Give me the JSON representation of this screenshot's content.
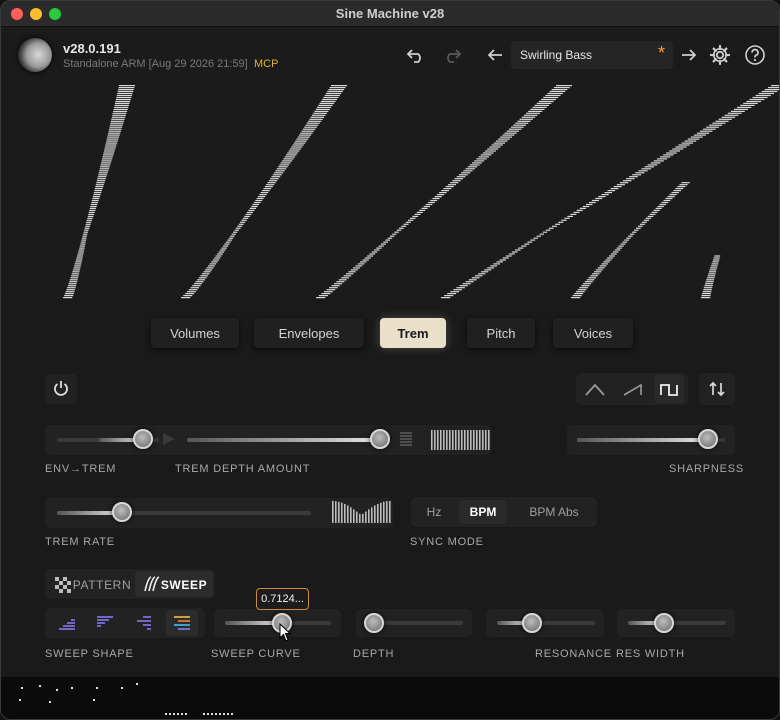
{
  "window": {
    "title": "Sine Machine v28"
  },
  "header": {
    "version": "v28.0.191",
    "build_info": "Standalone ARM [Aug 29 2026 21:59]",
    "badge": "MCP",
    "preset_name": "Swirling Bass",
    "preset_modified_marker": "*",
    "icons": [
      "undo-icon",
      "redo-icon",
      "prev-preset-icon",
      "next-preset-icon",
      "gear-icon",
      "help-icon"
    ]
  },
  "tabs": [
    {
      "label": "Volumes",
      "active": false
    },
    {
      "label": "Envelopes",
      "active": false
    },
    {
      "label": "Trem",
      "active": true
    },
    {
      "label": "Pitch",
      "active": false
    },
    {
      "label": "Voices",
      "active": false
    }
  ],
  "controls": {
    "env_trem": {
      "label": "ENV→TREM",
      "value": 0.75
    },
    "trem_depth": {
      "label": "TREM DEPTH AMOUNT",
      "value": 1.0
    },
    "sharpness": {
      "label": "SHARPNESS",
      "value": 0.88
    },
    "trem_rate": {
      "label": "TREM RATE",
      "value": 0.25
    },
    "sync_mode": {
      "label": "SYNC MODE",
      "options": [
        "Hz",
        "BPM",
        "BPM Abs"
      ],
      "selected": "BPM"
    },
    "mode_toggle": {
      "options": [
        "PATTERN",
        "SWEEP"
      ],
      "selected": "SWEEP"
    },
    "sweep_shape": {
      "label": "SWEEP SHAPE"
    },
    "sweep_curve": {
      "label": "SWEEP CURVE",
      "value": 0.55,
      "tooltip": "0.7124..."
    },
    "depth": {
      "label": "DEPTH",
      "value": 0.0
    },
    "resonance": {
      "label": "RESONANCE",
      "value": 0.35
    },
    "res_width": {
      "label": "RES WIDTH",
      "value": 0.35
    },
    "wave_shapes": [
      "triangle-wave-icon",
      "saw-wave-icon",
      "square-wave-icon"
    ]
  },
  "colors": {
    "accent": "#eadfc9",
    "badge": "#e0b030",
    "star": "#ff9c40",
    "tooltip_border": "#c98a3a"
  }
}
